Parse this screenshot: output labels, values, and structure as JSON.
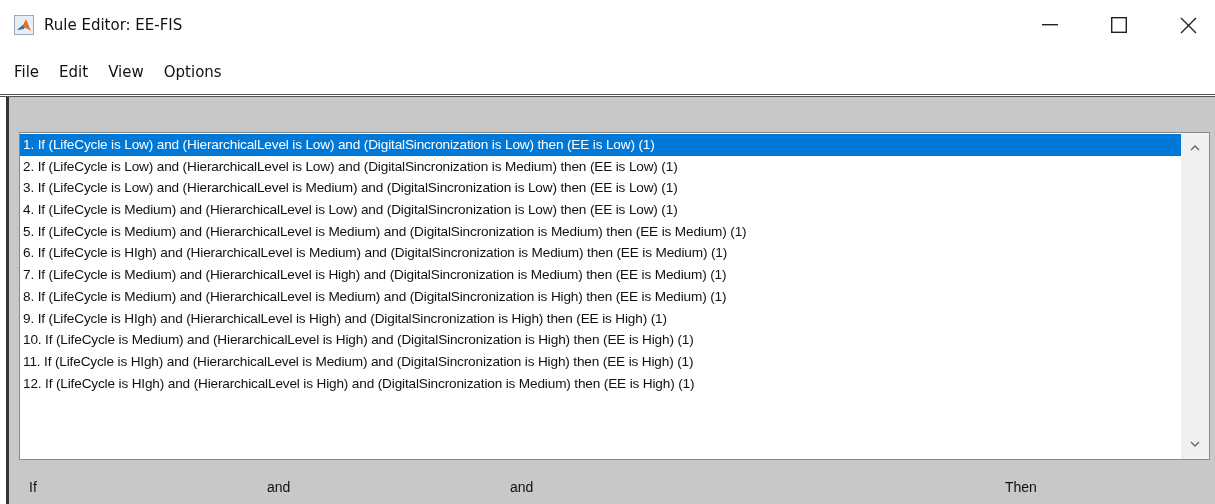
{
  "window": {
    "title": "Rule Editor: EE-FIS"
  },
  "menu": [
    "File",
    "Edit",
    "View",
    "Options"
  ],
  "rules": [
    {
      "text": "1. If (LifeCycle is Low) and (HierarchicalLevel is Low) and (DigitalSincronization is Low) then (EE is Low) (1)",
      "selected": true
    },
    {
      "text": "2. If (LifeCycle is Low) and (HierarchicalLevel is Low) and (DigitalSincronization is Medium) then (EE is Low) (1)",
      "selected": false
    },
    {
      "text": "3. If (LifeCycle is Low) and (HierarchicalLevel is Medium) and (DigitalSincronization is Low) then (EE is Low) (1)",
      "selected": false
    },
    {
      "text": "4. If (LifeCycle is Medium) and (HierarchicalLevel is Low) and (DigitalSincronization is Low) then (EE is Low) (1)",
      "selected": false
    },
    {
      "text": "5. If (LifeCycle is Medium) and (HierarchicalLevel is Medium) and (DigitalSincronization is Medium) then (EE is Medium) (1)",
      "selected": false
    },
    {
      "text": "6. If (LifeCycle is HIgh) and (HierarchicalLevel is Medium) and (DigitalSincronization is Medium) then (EE is Medium) (1)",
      "selected": false
    },
    {
      "text": "7. If (LifeCycle is Medium) and (HierarchicalLevel is High) and (DigitalSincronization is Medium) then (EE is Medium) (1)",
      "selected": false
    },
    {
      "text": "8. If (LifeCycle is Medium) and (HierarchicalLevel is Medium) and (DigitalSincronization is High) then (EE is Medium) (1)",
      "selected": false
    },
    {
      "text": "9. If (LifeCycle is HIgh) and (HierarchicalLevel is High) and (DigitalSincronization is High) then (EE is High) (1)",
      "selected": false
    },
    {
      "text": "10. If (LifeCycle is Medium) and (HierarchicalLevel is High) and (DigitalSincronization is High) then (EE is High) (1)",
      "selected": false
    },
    {
      "text": "11. If (LifeCycle is HIgh) and (HierarchicalLevel is Medium) and (DigitalSincronization is High) then (EE is High) (1)",
      "selected": false
    },
    {
      "text": "12. If (LifeCycle is HIgh) and (HierarchicalLevel is High) and (DigitalSincronization is Medium) then (EE is High) (1)",
      "selected": false
    }
  ],
  "labels": [
    "If",
    "and",
    "and",
    "Then"
  ]
}
